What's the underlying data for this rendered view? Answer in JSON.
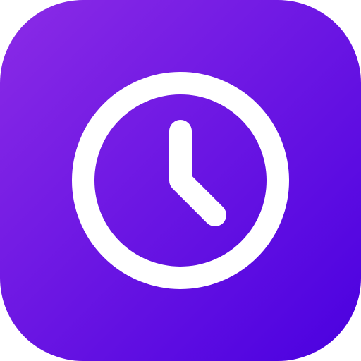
{
  "app_icon": {
    "icon": "clock-icon",
    "gradient": {
      "start": "#8B2BE6",
      "end": "#4A00E0"
    },
    "glyph_color": "#FFFFFF"
  }
}
